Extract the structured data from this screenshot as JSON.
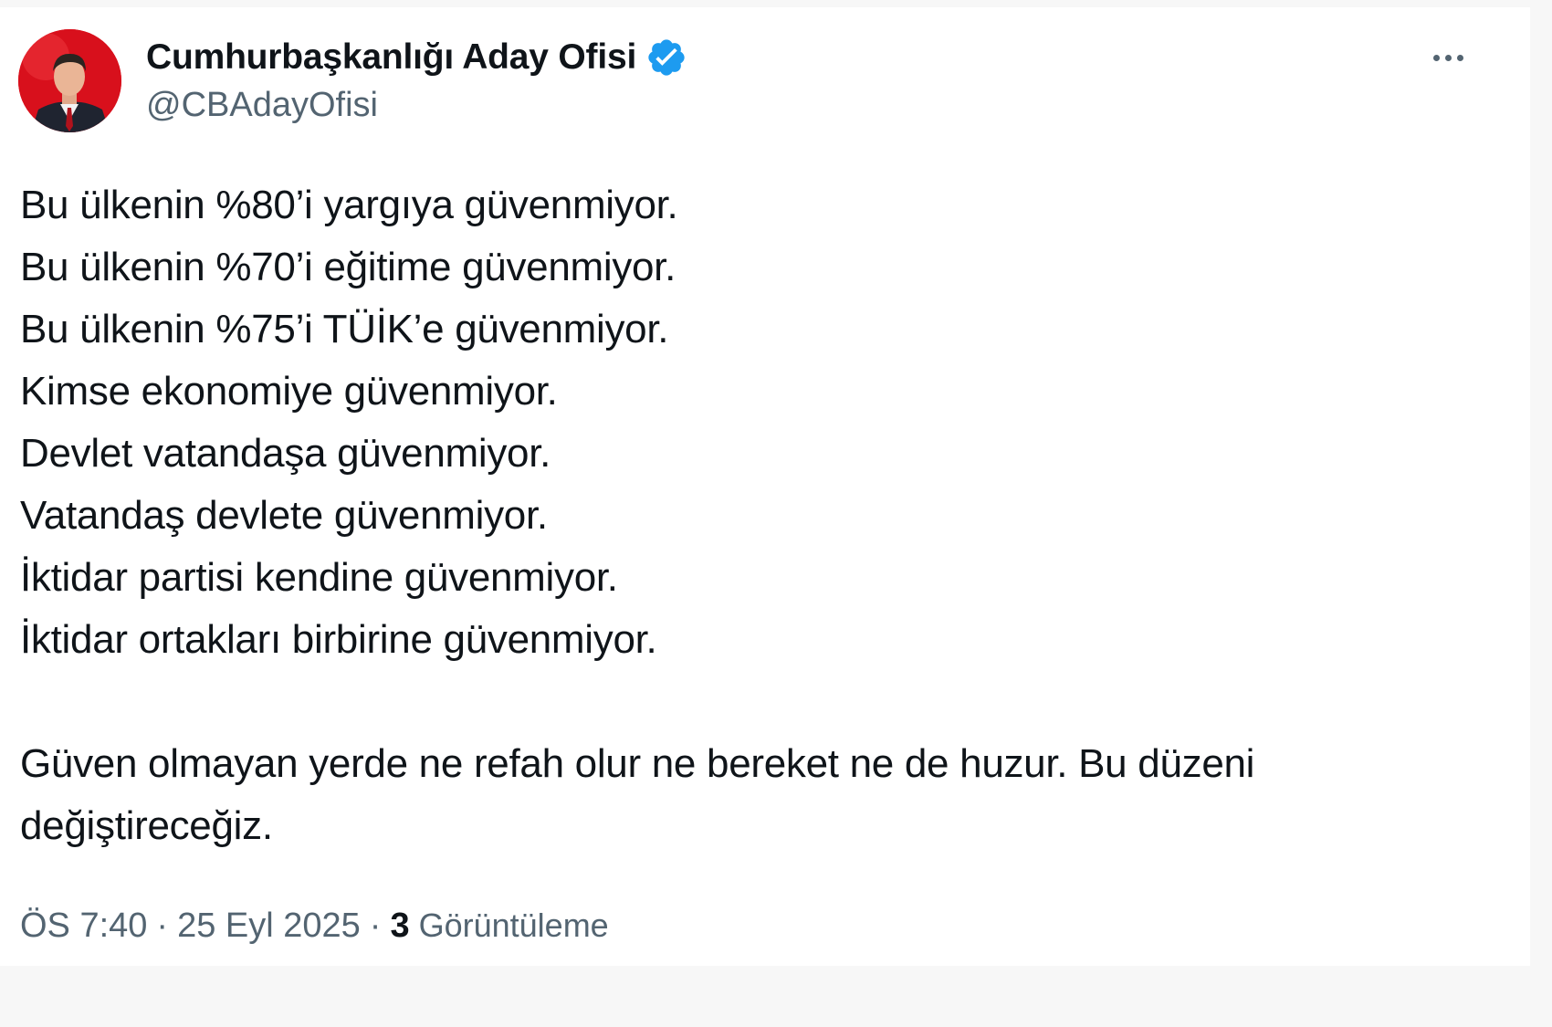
{
  "account": {
    "display_name": "Cumhurbaşkanlığı Aday Ofisi",
    "handle": "@CBAdayOfisi",
    "verified": true,
    "avatar_bg_color": "#e30a17",
    "verified_color": "#1d9bf0"
  },
  "tweet": {
    "lines": [
      "Bu ülkenin %80’i yargıya güvenmiyor.",
      "Bu ülkenin %70’i eğitime güvenmiyor.",
      "Bu ülkenin %75’i TÜİK’e güvenmiyor.",
      "Kimse ekonomiye güvenmiyor.",
      "Devlet vatandaşa güvenmiyor.",
      "Vatandaş devlete güvenmiyor.",
      "İktidar partisi kendine güvenmiyor.",
      "İktidar ortakları birbirine güvenmiyor."
    ],
    "closing": "Güven olmayan yerde ne refah olur ne bereket ne de huzur.  Bu düzeni değiştireceğiz."
  },
  "meta": {
    "time": "ÖS 7:40",
    "separator": "·",
    "date": "25 Eyl 2025",
    "views_count": "3",
    "views_label": "Görüntüleme"
  },
  "icons": {
    "verified": "verified-badge-icon",
    "more": "more-options-icon"
  }
}
